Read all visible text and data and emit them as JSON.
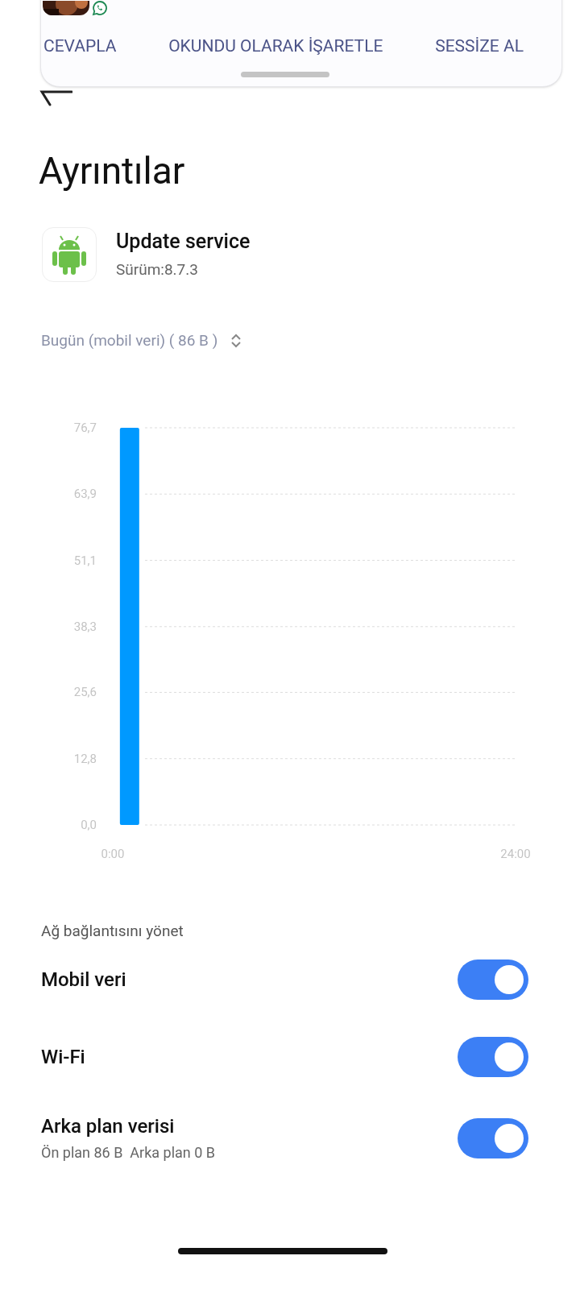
{
  "notification": {
    "kind": "picture",
    "actions": [
      "CEVAPLA",
      "OKUNDU OLARAK İŞARETLE",
      "SESSİZE AL"
    ]
  },
  "title": "Ayrıntılar",
  "app": {
    "name": "Update service",
    "version": "Sürüm:8.7.3"
  },
  "period": {
    "label": "Bugün (mobil veri) ( 86 B )"
  },
  "usage_chart": {
    "chart_data": {
      "type": "bar",
      "grid": true,
      "x": [
        1
      ],
      "values": [
        76.7
      ],
      "xlim": [
        0,
        24
      ],
      "ylim": [
        0,
        76.7
      ],
      "xticks": [
        {
          "value": 0,
          "label": "0:00"
        },
        {
          "value": 24,
          "label": "24:00"
        }
      ],
      "yticks": [
        {
          "value": 0,
          "label": "0,0"
        },
        {
          "value": 12.8,
          "label": "12,8"
        },
        {
          "value": 25.6,
          "label": "25,6"
        },
        {
          "value": 38.3,
          "label": "38,3"
        },
        {
          "value": 51.1,
          "label": "51,1"
        },
        {
          "value": 63.9,
          "label": "63,9"
        },
        {
          "value": 76.7,
          "label": "76,7"
        }
      ]
    }
  },
  "section_label": "Ağ bağlantısını yönet",
  "settings": [
    {
      "label": "Mobil veri",
      "on": true
    },
    {
      "label": "Wi-Fi",
      "on": true
    },
    {
      "label": "Arka plan verisi",
      "on": true,
      "detail": "Ön plan 86 B  Arka plan 0 B"
    }
  ]
}
